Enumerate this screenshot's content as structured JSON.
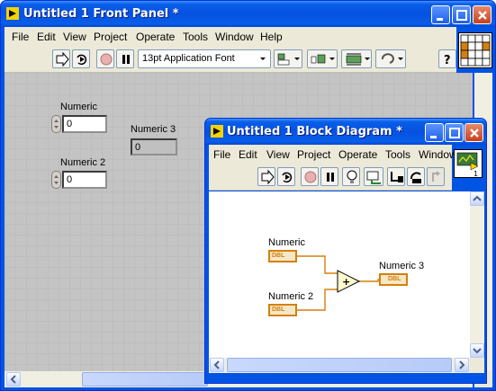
{
  "front_panel": {
    "title": "Untitled 1 Front Panel *",
    "menu": [
      "File",
      "Edit",
      "View",
      "Project",
      "Operate",
      "Tools",
      "Window",
      "Help"
    ],
    "font_select": "13pt Application Font",
    "controls": [
      {
        "label": "Numeric",
        "value": "0"
      },
      {
        "label": "Numeric 2",
        "value": "0"
      }
    ],
    "indicator": {
      "label": "Numeric 3",
      "value": "0"
    }
  },
  "block_diagram": {
    "title": "Untitled 1 Block Diagram *",
    "menu": [
      "File",
      "Edit",
      "View",
      "Project",
      "Operate",
      "Tools",
      "Window"
    ],
    "terminals": [
      {
        "label": "Numeric",
        "type": "DBL"
      },
      {
        "label": "Numeric 2",
        "type": "DBL"
      },
      {
        "label": "Numeric 3",
        "type": "DBL"
      }
    ],
    "add_function": "+"
  },
  "colors": {
    "title_bar": "#0a5ee8",
    "wire": "#d4800c",
    "canvas": "#c4c4c4"
  },
  "icons": [
    "run-arrow-icon",
    "run-continuous-icon",
    "abort-icon",
    "pause-icon",
    "help-icon",
    "highlight-execution-icon"
  ]
}
